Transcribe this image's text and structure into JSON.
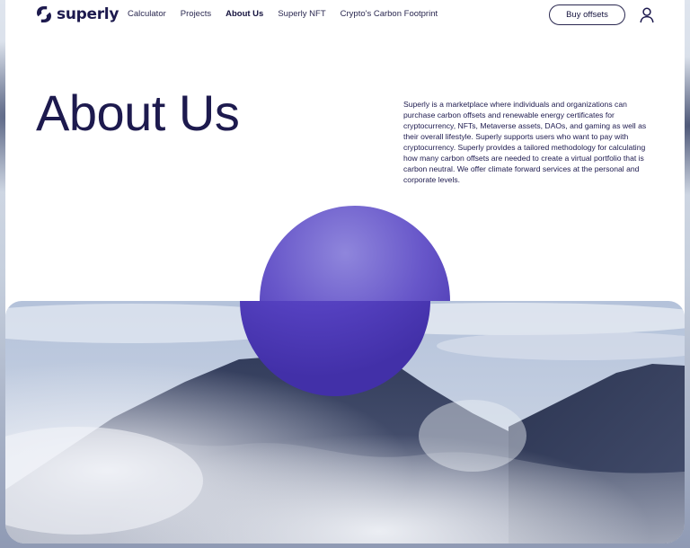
{
  "brand": {
    "name": "superly"
  },
  "nav": {
    "items": [
      {
        "label": "Calculator",
        "active": false
      },
      {
        "label": "Projects",
        "active": false
      },
      {
        "label": "About Us",
        "active": true
      },
      {
        "label": "Superly NFT",
        "active": false
      },
      {
        "label": "Crypto's Carbon Footprint",
        "active": false
      }
    ],
    "cta_label": "Buy offsets",
    "user_icon": "user-icon"
  },
  "hero": {
    "title": "About Us",
    "description": "Superly is a marketplace where individuals and organizations can purchase carbon offsets and renewable energy certificates for cryptocurrency, NFTs, Metaverse assets, DAOs, and gaming as well as their overall lifestyle. Superly supports users who want to pay with cryptocurrency. Superly provides a tailored methodology for calculating how many carbon offsets are needed to create a virtual portfolio that is carbon neutral. We offer climate forward services at the personal and corporate levels."
  },
  "colors": {
    "brand_navy": "#1d1a4e",
    "sphere_purple": "#5a47c0",
    "background": "#ffffff"
  }
}
